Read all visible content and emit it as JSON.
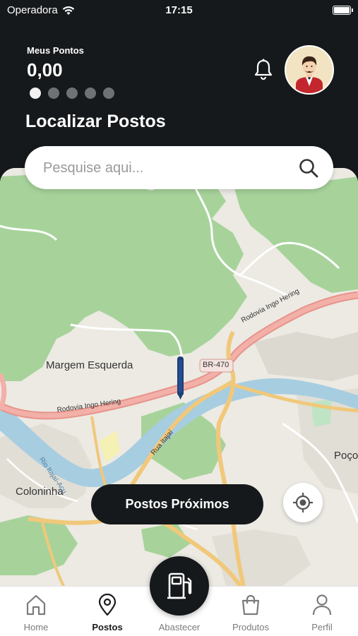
{
  "status_bar": {
    "carrier": "Operadora",
    "time": "17:15"
  },
  "header": {
    "points_label": "Meus Pontos",
    "points_value": "0,00",
    "carousel_pages": 5,
    "carousel_active_index": 0,
    "title": "Localizar Postos"
  },
  "search": {
    "placeholder": "Pesquise aqui..."
  },
  "map": {
    "labels": {
      "margem_esquerda": "Margem Esquerda",
      "coloninha": "Coloninha",
      "poco": "Poço",
      "br470": "BR-470",
      "rodovia_ingo_hering_1": "Rodovia Ingo Hering",
      "rodovia_ingo_hering_2": "Rodovia Ingo Hering",
      "rua_itajai": "Rua Itajaí",
      "rio_itajai_acu": "Rio Itajaí-Açu"
    }
  },
  "buttons": {
    "nearby": "Postos Próximos"
  },
  "tabbar": {
    "home": "Home",
    "postos": "Postos",
    "abastecer": "Abastecer",
    "produtos": "Produtos",
    "perfil": "Perfil",
    "active": "postos"
  },
  "colors": {
    "header_bg": "#16191b",
    "forest": "#a7d39b",
    "river": "#a7cde0",
    "highway": "#ec9b93",
    "road": "#f1c87a"
  }
}
